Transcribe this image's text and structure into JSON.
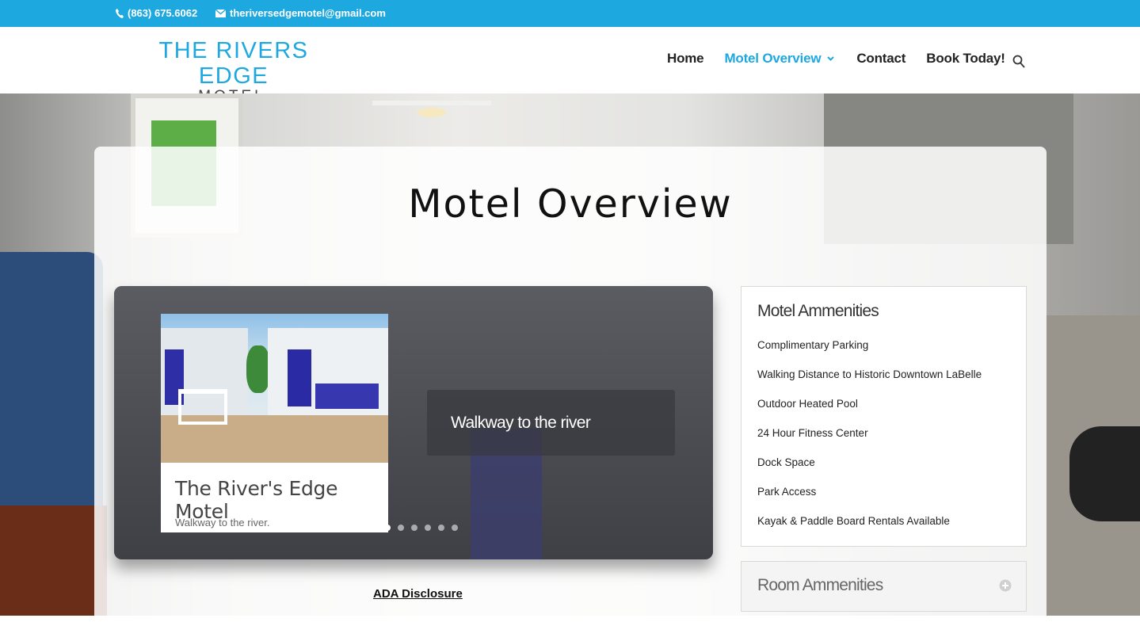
{
  "topbar": {
    "phone": "(863) 675.6062",
    "email": "theriversedgemotel@gmail.com",
    "bg_color": "#1ea8e0"
  },
  "logo": {
    "line1": "THE RIVERS EDGE",
    "line2": "MOTEL"
  },
  "nav": {
    "home": "Home",
    "overview": "Motel Overview",
    "contact": "Contact",
    "book": "Book Today!",
    "active_color": "#1ea8e0"
  },
  "page": {
    "title": "Motel Overview"
  },
  "slider": {
    "image_title": "The River's Edge Motel",
    "image_subtitle": "Walkway to the river.",
    "description": "Walkway to the river",
    "total_slides": 6,
    "active_slide": 1
  },
  "links": {
    "ada": "ADA Disclosure"
  },
  "amenities": {
    "motel_title": "Motel Ammenities",
    "motel_items": [
      "Complimentary Parking",
      "Walking Distance to Historic Downtown LaBelle",
      "Outdoor Heated Pool",
      "24 Hour Fitness Center",
      "Dock Space",
      "Park Access",
      "Kayak & Paddle Board Rentals Available"
    ],
    "room_title": "Room Ammenities"
  }
}
